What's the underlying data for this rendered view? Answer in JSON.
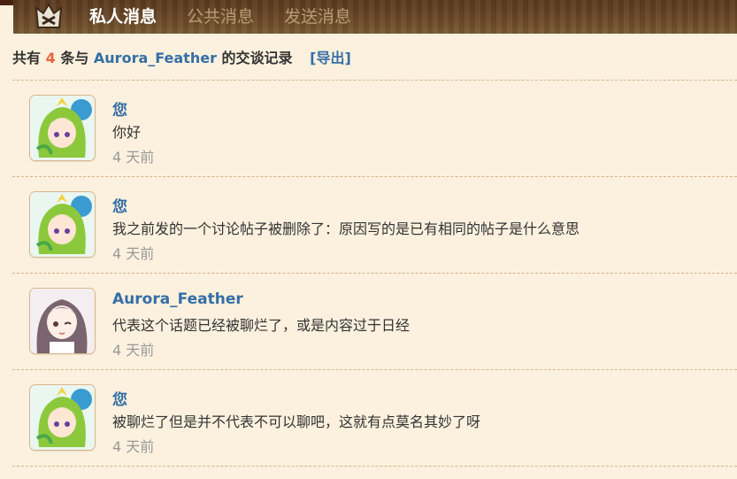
{
  "tabs": [
    {
      "label": "私人消息",
      "active": true
    },
    {
      "label": "公共消息",
      "active": false
    },
    {
      "label": "发送消息",
      "active": false
    }
  ],
  "summary": {
    "prefix": "共有",
    "count": "4",
    "middle": "条与",
    "partner": "Aurora_Feather",
    "suffix": "的交谈记录",
    "export_label": "[导出]"
  },
  "messages": [
    {
      "sender": "您",
      "text": "你好",
      "time": "4 天前",
      "avatar": "green-hair-avatar"
    },
    {
      "sender": "您",
      "text": "我之前发的一个讨论帖子被删除了：原因写的是已有相同的帖子是什么意思",
      "time": "4 天前",
      "avatar": "green-hair-avatar"
    },
    {
      "sender": "Aurora_Feather",
      "text": "代表这个话题已经被聊烂了，或是内容过于日经",
      "time": "4 天前",
      "avatar": "brown-hair-avatar"
    },
    {
      "sender": "您",
      "text": "被聊烂了但是并不代表不可以聊吧，这就有点莫名其妙了呀",
      "time": "4 天前",
      "avatar": "green-hair-avatar"
    }
  ],
  "colors": {
    "background": "#fbf1de",
    "link": "#356ea6",
    "count": "#e8643c",
    "muted": "#999999"
  }
}
